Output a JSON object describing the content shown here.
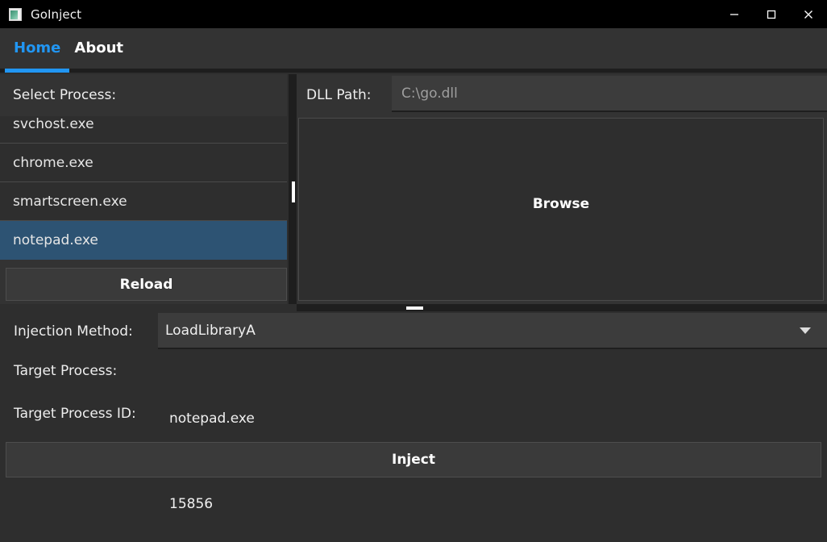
{
  "window": {
    "title": "GoInject",
    "icon": "app-window-icon",
    "controls": {
      "minimize": "minimize-icon",
      "maximize": "maximize-icon",
      "close": "close-icon"
    }
  },
  "tabs": [
    {
      "label": "Home",
      "active": true
    },
    {
      "label": "About",
      "active": false
    }
  ],
  "left_panel": {
    "header": "Select Process:",
    "processes": [
      {
        "name": "svchost.exe",
        "selected": false
      },
      {
        "name": "chrome.exe",
        "selected": false
      },
      {
        "name": "smartscreen.exe",
        "selected": false
      },
      {
        "name": "notepad.exe",
        "selected": true
      }
    ],
    "reload_label": "Reload"
  },
  "right_panel": {
    "dll_label": "DLL Path:",
    "dll_value": "",
    "dll_placeholder": "C:\\go.dll",
    "browse_label": "Browse"
  },
  "form": {
    "injection_method_label": "Injection Method:",
    "injection_method_value": "LoadLibraryA",
    "injection_method_arrow": "chevron-down-icon",
    "target_process_label": "Target Process:",
    "target_process_value": "notepad.exe",
    "target_pid_label": "Target Process ID:",
    "target_pid_value": "15856"
  },
  "actions": {
    "inject_label": "Inject"
  },
  "colors": {
    "accent": "#2196f3",
    "selection": "#2d5373",
    "window_bg": "#2e2e2e",
    "panel_bg": "#333333",
    "titlebar_bg": "#000000",
    "field_bg": "#3c3c3c"
  }
}
